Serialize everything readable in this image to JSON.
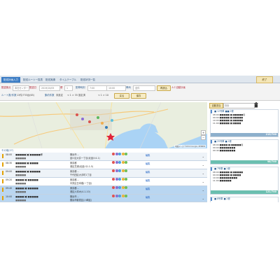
{
  "tabs": [
    {
      "label": "配送計画入力",
      "active": true
    },
    {
      "label": "配送ルート一覧表",
      "active": false
    },
    {
      "label": "配送実績",
      "active": false
    },
    {
      "label": "タイムテーブル",
      "active": false
    },
    {
      "label": "配送状況一覧",
      "active": false
    }
  ],
  "help_label": "終了",
  "filters": {
    "row1": {
      "label1": "配送拠点",
      "value1": "本社センター",
      "label2": "配送日",
      "value2": "2019/10/05",
      "label3": "便",
      "value3": "1",
      "label4": "配車時刻",
      "value4": "7:00",
      "label5": "",
      "value5": "10:00",
      "label6": "車両",
      "value6": "全件",
      "button1": "再読込",
      "link1": "ＡＩ自動計画"
    },
    "row2": {
      "label1": "ルート数/件数",
      "text1": "13件/733台(65)",
      "label2": "集約件数",
      "text2": "未設定",
      "pager": "< 1 > 35 設定済",
      "pager2": "< 1 > 10",
      "button1": "戻る",
      "button2": "保存"
    }
  },
  "map": {
    "credit": "地図データ ©2019 Google, ZENRIN",
    "zoom_in": "+",
    "zoom_out": "−"
  },
  "table": {
    "title": "その他(27)",
    "rows": [
      {
        "time": "08:00",
        "name": "■■■■■(■)■■■■■様",
        "sub": "■■■■■",
        "addr": "横浜市...",
        "addr2": "品川区大井一丁目(北品川4-1)",
        "edit": "編集",
        "sel": false
      },
      {
        "time": "08:30",
        "name": "■■■■■(■)■■■■",
        "sub": "■■■■■",
        "addr": "東京都",
        "addr2": "港区芝浦(北品川2-1-5)",
        "edit": "編集",
        "sel": false
      },
      {
        "time": "09:00",
        "name": "■■■■■(■)■■■■■",
        "sub": "■■■■■",
        "addr": "東京都...",
        "addr2": "千代田区大手町1丁目",
        "edit": "編集",
        "sel": false
      },
      {
        "time": "09:20",
        "name": "■■■■(■)■■■■■",
        "sub": "■■■■■",
        "addr": "東京都...",
        "addr2": "中央区日本橋(一丁目)",
        "edit": "編集",
        "sel": false
      },
      {
        "time": "09:40",
        "name": "■■■■(■)■■■■■",
        "sub": "■■■■■",
        "addr": "東京都...",
        "addr2": "港区六本木(4-1-10)",
        "edit": "編集",
        "sel": true
      },
      {
        "time": "10:00",
        "name": "■■■■(■)■■■■■",
        "sub": "■■■■■",
        "addr": "横浜市...",
        "addr2": "横浜市鶴見区(川崎区)",
        "edit": "編集",
        "sel": true
      }
    ]
  },
  "right_panel": {
    "button": "自動割当",
    "search_placeholder": "検索",
    "cards": [
      {
        "head": "■ 12号車  ■■ 2便",
        "lines": [
          "08:00  ■■■■■(■)■■■■■様",
          "09:00  ■■■■■(■)■■■■■",
          "10:00  ■■■■■(■)■■■■■",
          "11:00  ■■■■■(■)■■■■"
        ],
        "count": "215/700"
      },
      {
        "head": "■ 25号車  ■ 1便",
        "lines": [
          "08:00  ■■■■(■)■■■■■様",
          "09:00  ■■■■■■■■",
          "09:40  ■■■■■■■■"
        ],
        "count": "98/700"
      },
      {
        "head": "■ 7号車  ■ 1便",
        "lines": [
          "08:00  ■■■■■(■)■■■■■",
          "09:00  ■■■■■(■)■■■■",
          "10:00  ■■■■■■■■■",
          "11:00  ■■■■■■"
        ],
        "count": "121/700"
      },
      {
        "head": "■ 8号車  ■ 2便",
        "lines": [
          "08:00  ■■■■■(■)■■■■■",
          "09:00  ■■■■■■■■"
        ],
        "count": ""
      }
    ]
  }
}
